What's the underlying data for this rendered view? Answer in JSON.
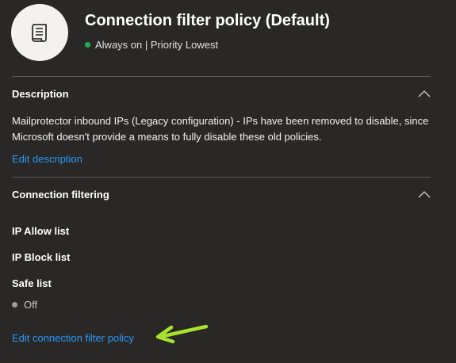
{
  "header": {
    "title": "Connection filter policy (Default)",
    "status": "Always on | Priority Lowest",
    "status_color": "#1fb14a",
    "icon": "policy-scroll-icon"
  },
  "description": {
    "title": "Description",
    "text": "Mailprotector inbound IPs (Legacy configuration) - IPs have been removed to disable, since Microsoft doesn't provide a means to fully disable these old policies.",
    "edit_link": "Edit description"
  },
  "connection_filtering": {
    "title": "Connection filtering",
    "ip_allow_list_label": "IP Allow list",
    "ip_block_list_label": "IP Block list",
    "safe_list_label": "Safe list",
    "safe_list_value": "Off",
    "edit_link": "Edit connection filter policy"
  },
  "colors": {
    "background": "#292827",
    "link": "#2899f5",
    "annotation_arrow": "#a6e22e"
  }
}
